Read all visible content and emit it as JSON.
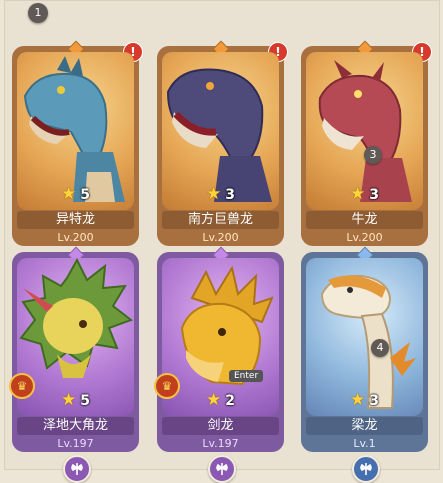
{
  "step_markers": [
    "1",
    "3",
    "4"
  ],
  "tooltip": "Enter",
  "cards": [
    {
      "name": "异特龙",
      "level": "Lv.200",
      "stars": "5",
      "rarity": "orange",
      "alert": "!",
      "crown": false
    },
    {
      "name": "南方巨兽龙",
      "level": "Lv.200",
      "stars": "3",
      "rarity": "orange",
      "alert": "!",
      "crown": false
    },
    {
      "name": "牛龙",
      "level": "Lv.200",
      "stars": "3",
      "rarity": "orange",
      "alert": "!",
      "crown": false
    },
    {
      "name": "泽地大角龙",
      "level": "Lv.197",
      "stars": "5",
      "rarity": "purple",
      "alert": "",
      "crown": true
    },
    {
      "name": "剑龙",
      "level": "Lv.197",
      "stars": "2",
      "rarity": "purple",
      "alert": "",
      "crown": true
    },
    {
      "name": "梁龙",
      "level": "Lv.1",
      "stars": "3",
      "rarity": "blue",
      "alert": "",
      "crown": false
    }
  ],
  "colors": {
    "orange_card": "#a9703f",
    "purple_card": "#7e5aa0",
    "blue_card": "#5e7598",
    "alert": "#d73a2c",
    "star": "#ffd43a"
  },
  "icons": [
    "star-icon",
    "axe-icon",
    "crown-icon",
    "alert-icon",
    "rarity-diamond-icon"
  ]
}
